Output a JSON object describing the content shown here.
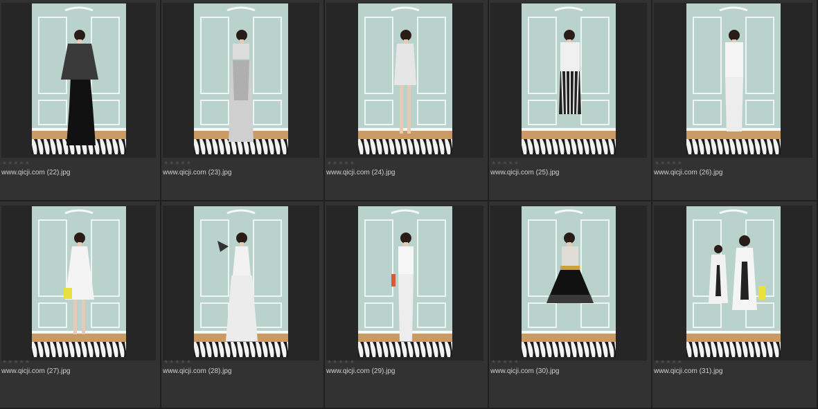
{
  "colors": {
    "background": "#2b2b2b",
    "cell": "#323232",
    "wall": "#b9d3cc",
    "floor": "#c99a63"
  },
  "rating_icon": "star-icon",
  "items": [
    {
      "filename": "www.qicji.com  (22).jpg",
      "stars": "★★★★★",
      "outfit": "black-gown-shawl"
    },
    {
      "filename": "www.qicji.com  (23).jpg",
      "stars": "★★★★★",
      "outfit": "print-top-sheer-skirt"
    },
    {
      "filename": "www.qicji.com  (24).jpg",
      "stars": "★★★★★",
      "outfit": "print-mini-dress"
    },
    {
      "filename": "www.qicji.com  (25).jpg",
      "stars": "★★★★★",
      "outfit": "striped-pants-jacket"
    },
    {
      "filename": "www.qicji.com  (26).jpg",
      "stars": "★★★★★",
      "outfit": "white-shirt-trousers"
    },
    {
      "filename": "www.qicji.com  (27).jpg",
      "stars": "★★★★★",
      "outfit": "white-shift-dress"
    },
    {
      "filename": "www.qicji.com  (28).jpg",
      "stars": "★★★★★",
      "outfit": "white-jumpsuit-fan"
    },
    {
      "filename": "www.qicji.com  (29).jpg",
      "stars": "★★★★★",
      "outfit": "white-top-trousers"
    },
    {
      "filename": "www.qicji.com  (30).jpg",
      "stars": "★★★★★",
      "outfit": "black-full-skirt"
    },
    {
      "filename": "www.qicji.com  (31).jpg",
      "stars": "★★★★★",
      "outfit": "two-printed-dresses"
    }
  ]
}
